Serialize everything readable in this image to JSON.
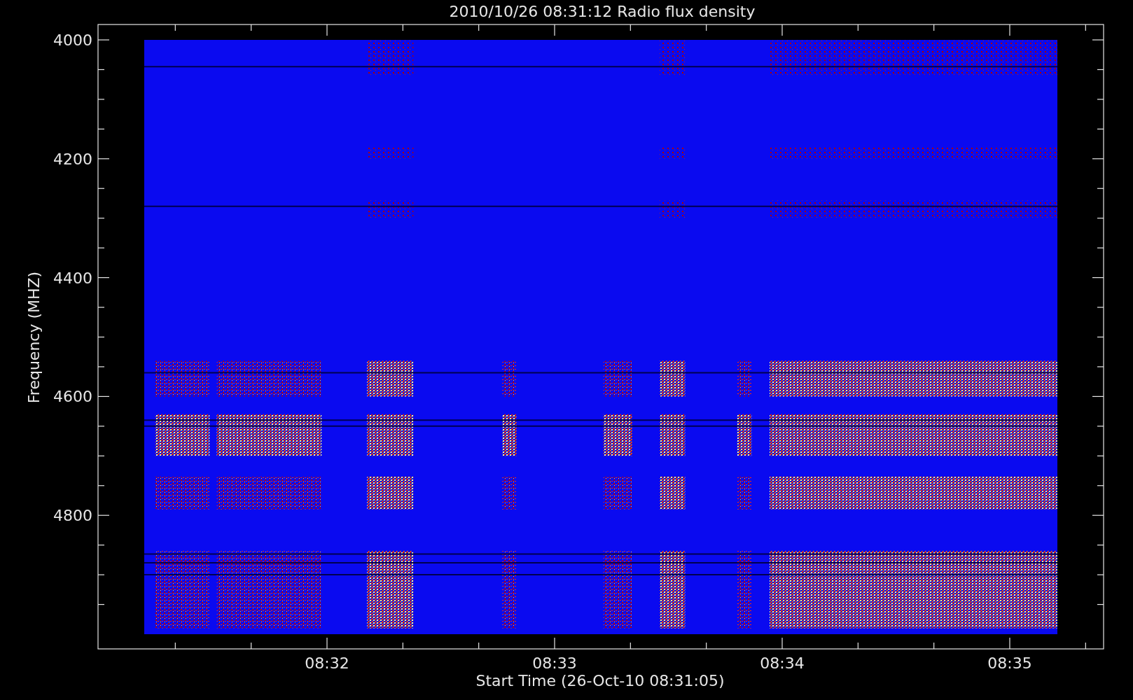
{
  "title": "2010/10/26 08:31:12 Radio flux density",
  "plot": {
    "ylabel": "Frequency (MHZ)",
    "xlabel": "Start Time (26-Oct-10 08:31:05)",
    "yticks": [
      "4000",
      "4200",
      "4400",
      "4600",
      "4800"
    ],
    "xticks": [
      "08:32",
      "08:33",
      "08:34",
      "08:35"
    ]
  }
}
